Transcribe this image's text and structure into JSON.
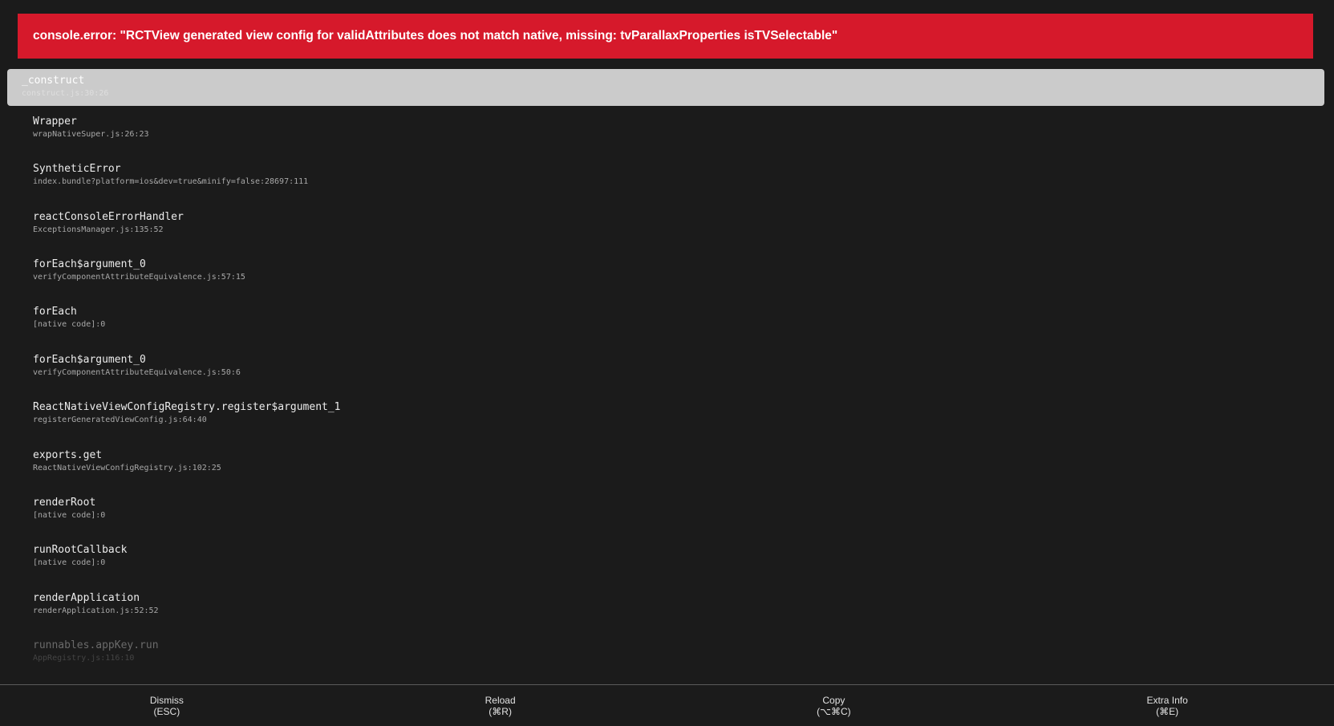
{
  "error": {
    "message": "console.error: \"RCTView generated view config for validAttributes does not match native, missing: tvParallaxProperties isTVSelectable\""
  },
  "stack": [
    {
      "fn": "_construct",
      "loc": "construct.js:30:26"
    },
    {
      "fn": "Wrapper",
      "loc": "wrapNativeSuper.js:26:23"
    },
    {
      "fn": "SyntheticError",
      "loc": "index.bundle?platform=ios&dev=true&minify=false:28697:111"
    },
    {
      "fn": "reactConsoleErrorHandler",
      "loc": "ExceptionsManager.js:135:52"
    },
    {
      "fn": "forEach$argument_0",
      "loc": "verifyComponentAttributeEquivalence.js:57:15"
    },
    {
      "fn": "forEach",
      "loc": "[native code]:0"
    },
    {
      "fn": "forEach$argument_0",
      "loc": "verifyComponentAttributeEquivalence.js:50:6"
    },
    {
      "fn": "ReactNativeViewConfigRegistry.register$argument_1",
      "loc": "registerGeneratedViewConfig.js:64:40"
    },
    {
      "fn": "exports.get",
      "loc": "ReactNativeViewConfigRegistry.js:102:25"
    },
    {
      "fn": "renderRoot",
      "loc": "[native code]:0"
    },
    {
      "fn": "runRootCallback",
      "loc": "[native code]:0"
    },
    {
      "fn": "renderApplication",
      "loc": "renderApplication.js:52:52"
    },
    {
      "fn": "runnables.appKey.run",
      "loc": "AppRegistry.js:116:10"
    }
  ],
  "footer": {
    "dismiss": {
      "label": "Dismiss",
      "shortcut": "(ESC)"
    },
    "reload": {
      "label": "Reload",
      "shortcut": "(⌘R)"
    },
    "copy": {
      "label": "Copy",
      "shortcut": "(⌥⌘C)"
    },
    "extra_info": {
      "label": "Extra Info",
      "shortcut": "(⌘E)"
    }
  },
  "colors": {
    "background": "#1b1b1b",
    "error_banner": "#d6192b",
    "selected_frame": "#cbcbcb"
  }
}
